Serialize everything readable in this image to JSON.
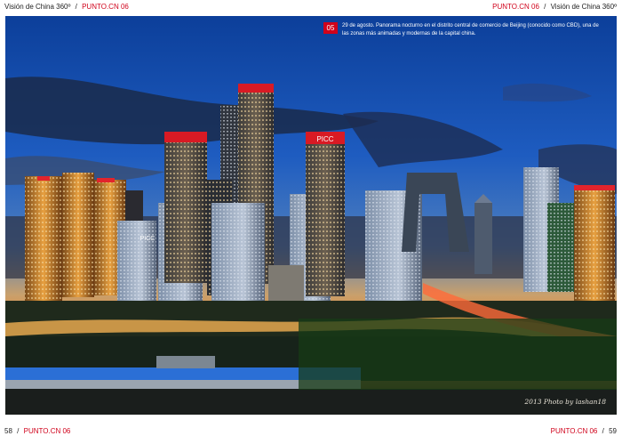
{
  "header": {
    "left_title": "Visión de China 360º",
    "left_sep": "/",
    "left_mag": "PUNTO.CN 06",
    "right_mag": "PUNTO.CN 06",
    "right_sep": "/",
    "right_title": "Visión de China 360º"
  },
  "photo": {
    "caption_number": "05",
    "caption": "29 de agosto. Panorama nocturno en el distrito central de comercio de Beijing (conocido como CBD), una de las zonas más animadas y modernas de la capital china.",
    "credit": "2013 Photo by lashan18",
    "building_signs": [
      "PICC",
      "PICC"
    ]
  },
  "footer": {
    "left_page": "58",
    "left_sep": "/",
    "left_mag": "PUNTO.CN 06",
    "right_mag": "PUNTO.CN 06",
    "right_sep": "/",
    "right_page": "59"
  },
  "colors": {
    "accent": "#d0021b"
  }
}
